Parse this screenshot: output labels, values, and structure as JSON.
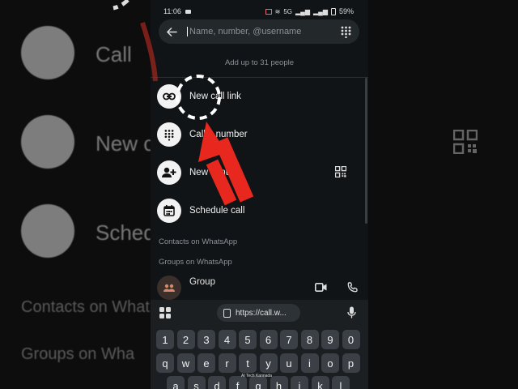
{
  "status": {
    "time": "11:06",
    "network": "5G",
    "battery": "59%"
  },
  "search": {
    "placeholder": "Name, number, @username"
  },
  "hint": "Add up to 31 people",
  "actions": [
    {
      "label": "New call link",
      "icon": "link-icon"
    },
    {
      "label": "Call a number",
      "icon": "dialpad-icon"
    },
    {
      "label": "New contact",
      "icon": "add-person-icon"
    },
    {
      "label": "Schedule call",
      "icon": "calendar-icon"
    }
  ],
  "sections": {
    "contacts": "Contacts on WhatsApp",
    "groups": "Groups on WhatsApp"
  },
  "group": {
    "name": "Group"
  },
  "keyboard": {
    "url_suggestion": "https://call.w...",
    "number_row": [
      "1",
      "2",
      "3",
      "4",
      "5",
      "6",
      "7",
      "8",
      "9",
      "0"
    ],
    "letter_row": [
      "q",
      "w",
      "e",
      "r",
      "t",
      "y",
      "u",
      "i",
      "o",
      "p"
    ],
    "third_row": [
      "a",
      "s",
      "d",
      "f",
      "g",
      "h",
      "j",
      "k",
      "l"
    ],
    "watermark": "AI Tech Kannada"
  },
  "background": {
    "left_items": [
      "Call",
      "New c",
      "Sched"
    ],
    "left_sections": [
      "Contacts on Whats",
      "Groups on Wha"
    ]
  },
  "colors": {
    "panel": "#111416",
    "accent_arrow": "#e8281e",
    "icon_bg": "#f2f2f2"
  }
}
